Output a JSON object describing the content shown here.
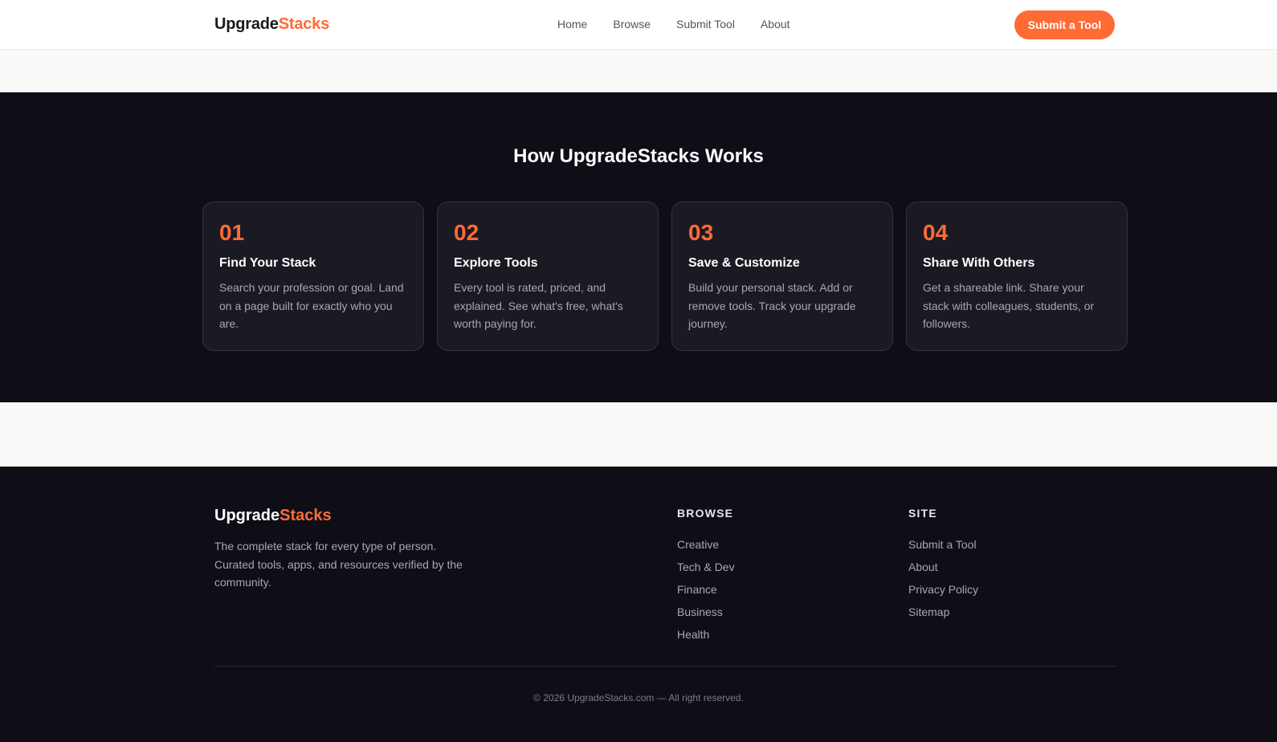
{
  "header": {
    "logo_main": "Upgrade",
    "logo_accent": "Stacks",
    "nav": [
      "Home",
      "Browse",
      "Submit Tool",
      "About"
    ],
    "cta": "Submit a Tool"
  },
  "how": {
    "title": "How UpgradeStacks Works",
    "steps": [
      {
        "num": "01",
        "title": "Find Your Stack",
        "desc": "Search your profession or goal. Land on a page built for exactly who you are."
      },
      {
        "num": "02",
        "title": "Explore Tools",
        "desc": "Every tool is rated, priced, and explained. See what's free, what's worth paying for."
      },
      {
        "num": "03",
        "title": "Save & Customize",
        "desc": "Build your personal stack. Add or remove tools. Track your upgrade journey."
      },
      {
        "num": "04",
        "title": "Share With Others",
        "desc": "Get a shareable link. Share your stack with colleagues, students, or followers."
      }
    ]
  },
  "footer": {
    "logo_main": "Upgrade",
    "logo_accent": "Stacks",
    "desc": "The complete stack for every type of person. Curated tools, apps, and resources verified by the community.",
    "browse": {
      "title": "BROWSE",
      "links": [
        "Creative",
        "Tech & Dev",
        "Finance",
        "Business",
        "Health"
      ]
    },
    "site": {
      "title": "SITE",
      "links": [
        "Submit a Tool",
        "About",
        "Privacy Policy",
        "Sitemap"
      ]
    },
    "copyright": "© 2026 UpgradeStacks.com — All right reserved."
  },
  "colors": {
    "accent": "#ff6b35",
    "dark_bg": "#0f0e17",
    "card_bg": "#1b1a23",
    "light_bg": "#faf9f7"
  }
}
